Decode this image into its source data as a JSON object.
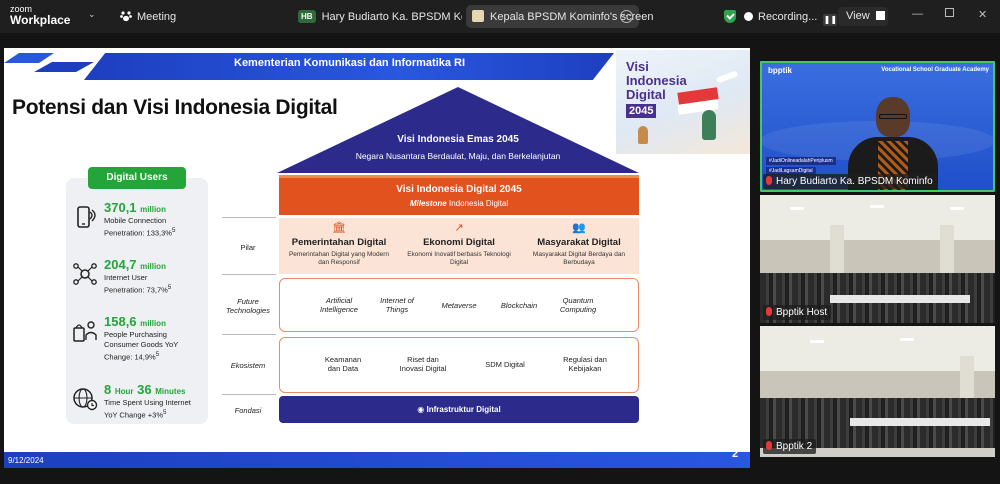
{
  "topbar": {
    "zoom_line1": "zoom",
    "zoom_line2": "Workplace",
    "meeting_label": "Meeting",
    "tab1_badge": "HB",
    "tab1_label": "Hary Budiarto Ka. BPSDM Kominfo's :",
    "tab2_label": "Kepala BPSDM Kominfo's screen",
    "recording_label": "Recording...",
    "view_label": "View"
  },
  "slide": {
    "header": "Kementerian Komunikasi dan Informatika RI",
    "title": "Potensi dan Visi Indonesia Digital",
    "visi_card": {
      "line1": "Visi",
      "line2": "Indonesia",
      "line3": "Digital",
      "year": "2045"
    },
    "digital_users_badge": "Digital Users",
    "stats": [
      {
        "value": "370,1",
        "unit": "million",
        "desc1": "Mobile Connection",
        "desc2": "Penetration: 133,3%",
        "sup": "5",
        "icon": "phone-wifi-icon"
      },
      {
        "value": "204,7",
        "unit": "million",
        "desc1": "Internet User",
        "desc2": "Penetration: 73,7%",
        "sup": "5",
        "icon": "network-users-icon"
      },
      {
        "value": "158,6",
        "unit": "million",
        "desc1": "People Purchasing",
        "desc2": "Consumer Goods YoY",
        "desc3": "Change: 14,9%",
        "sup": "5",
        "icon": "shopping-icon"
      },
      {
        "value_a": "8",
        "unit_a": "Hour",
        "value_b": "36",
        "unit_b": "Minutes",
        "desc1": "Time Spent Using Internet",
        "desc2": "YoY Change +3%",
        "sup": "5",
        "icon": "globe-clock-icon"
      }
    ],
    "roof_title": "Visi Indonesia Emas 2045",
    "roof_sub": "Negara Nusantara Berdaulat, Maju, dan Berkelanjutan",
    "visi_digital_title": "Visi Indonesia Digital 2045",
    "visi_digital_sub_italic": "Milestone",
    "visi_digital_sub_rest": " Indonesia Digital",
    "row_labels": {
      "pilar": "Pilar",
      "future1": "Future",
      "future2": "Technologies",
      "ekosistem": "Ekosistem",
      "fondasi": "Fondasi"
    },
    "pilars": [
      {
        "title": "Pemerintahan Digital",
        "desc": "Pemerintahan Digital yang Modern dan Responsif"
      },
      {
        "title": "Ekonomi Digital",
        "desc": "Ekonomi Inovatif berbasis Teknologi Digital"
      },
      {
        "title": "Masyarakat Digital",
        "desc": "Masyarakat Digital Berdaya dan Berbudaya"
      }
    ],
    "future_tech": [
      {
        "l1": "Artificial",
        "l2": "Intelligence"
      },
      {
        "l1": "Internet of",
        "l2": "Things"
      },
      {
        "l1": "Metaverse",
        "l2": ""
      },
      {
        "l1": "Blockchain",
        "l2": ""
      },
      {
        "l1": "Quantum",
        "l2": "Computing"
      }
    ],
    "ekosistem": [
      {
        "l1": "Keamanan",
        "l2": "dan Data"
      },
      {
        "l1": "Riset dan",
        "l2": "Inovasi Digital"
      },
      {
        "l1": "SDM Digital",
        "l2": ""
      },
      {
        "l1": "Regulasi dan",
        "l2": "Kebijakan"
      }
    ],
    "fondasi_label": "Infrastruktur Digital",
    "footer_date": "9/12/2024",
    "page_number": "2"
  },
  "tiles": [
    {
      "name": "Hary Budiarto Ka. BPSDM Kominfo",
      "logo": "bpptik",
      "academy": "Vocational School Graduate Academy",
      "tag1": "#JadiOnlineadalahPeriplusm",
      "tag2": "#JadiLagsamDigital"
    },
    {
      "name": "Bpptik Host"
    },
    {
      "name": "Bpptik 2"
    }
  ]
}
